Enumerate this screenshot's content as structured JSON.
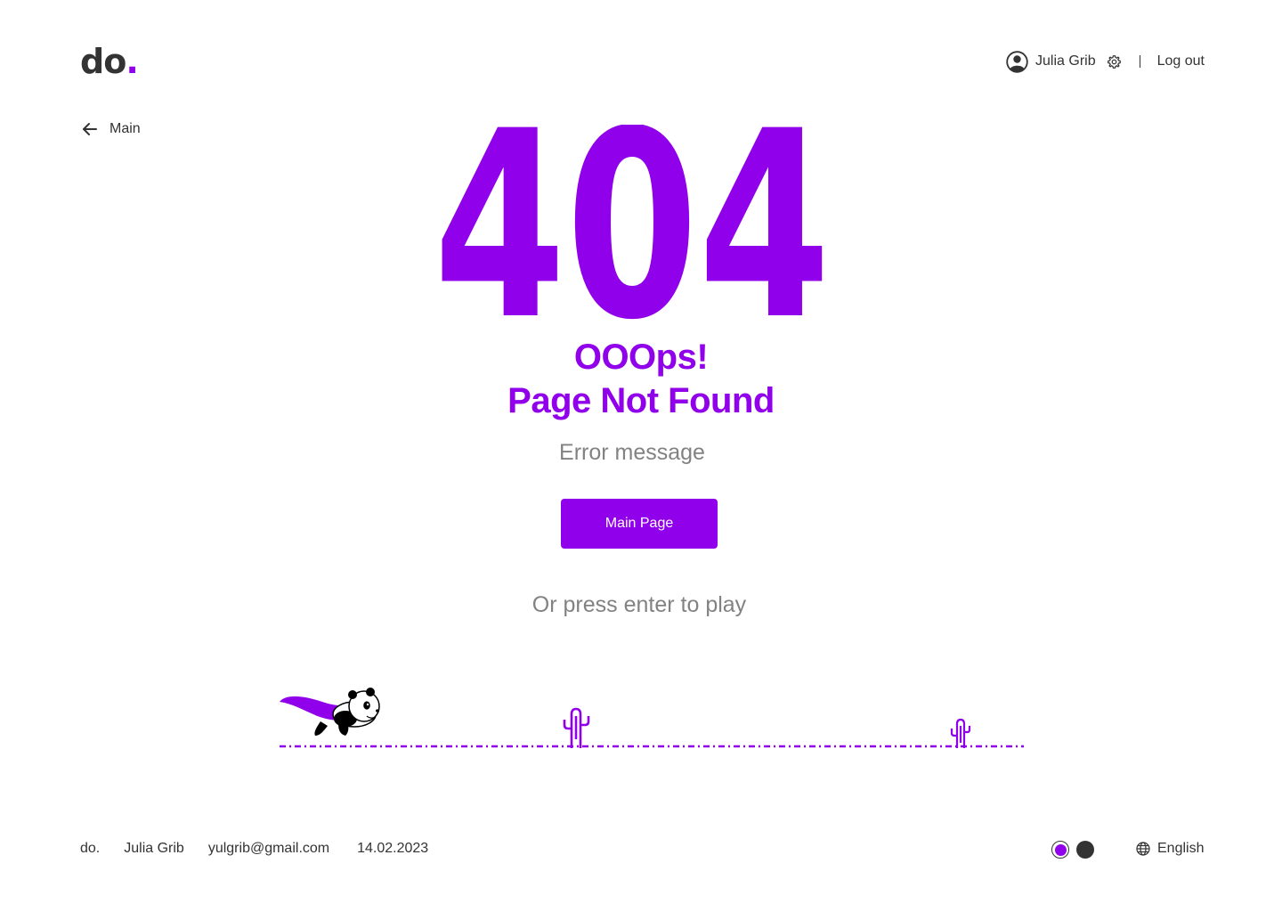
{
  "header": {
    "logo_text": "do",
    "logo_dot": ".",
    "user_name": "Julia Grib",
    "logout_label": "Log out"
  },
  "nav": {
    "back_label": "Main"
  },
  "main": {
    "code": "404",
    "title_line1": "OOOps!",
    "title_line2": "Page Not Found",
    "error_message": "Error message",
    "button_label": "Main Page",
    "play_hint": "Or press enter to play"
  },
  "footer": {
    "brand": "do.",
    "name": "Julia Grib",
    "email": "yulgrib@gmail.com",
    "date": "14.02.2023",
    "language": "English"
  },
  "colors": {
    "accent": "#9100EA",
    "text": "#333333",
    "muted": "#828282"
  },
  "icons": [
    "user-icon",
    "gear-icon",
    "arrow-left-icon",
    "globe-icon",
    "cactus-icon",
    "panda-icon"
  ]
}
